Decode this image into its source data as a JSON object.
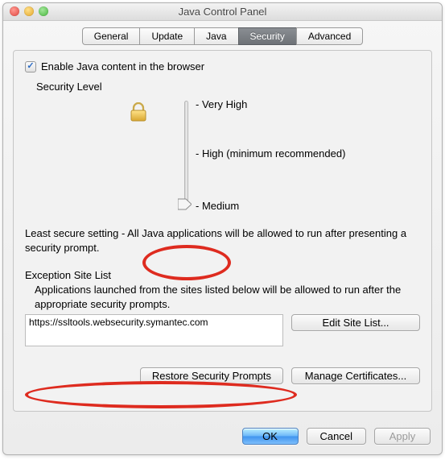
{
  "window": {
    "title": "Java Control Panel"
  },
  "tabs": {
    "general": "General",
    "update": "Update",
    "java": "Java",
    "security": "Security",
    "advanced": "Advanced",
    "active": "security"
  },
  "enable_checkbox": {
    "label": "Enable Java content in the browser",
    "checked": true
  },
  "security_level": {
    "heading": "Security Level",
    "options": {
      "very_high": "Very High",
      "high": "High (minimum recommended)",
      "medium": "Medium"
    },
    "selected": "medium",
    "description": "Least secure setting - All Java applications will be allowed to run after presenting a security prompt."
  },
  "exception_list": {
    "heading": "Exception Site List",
    "description": "Applications launched from the sites listed below will be allowed to run after the appropriate security prompts.",
    "items": [
      "https://ssltools.websecurity.symantec.com"
    ],
    "edit_button": "Edit Site List..."
  },
  "buttons": {
    "restore": "Restore Security Prompts",
    "manage": "Manage Certificates...",
    "ok": "OK",
    "cancel": "Cancel",
    "apply": "Apply"
  }
}
